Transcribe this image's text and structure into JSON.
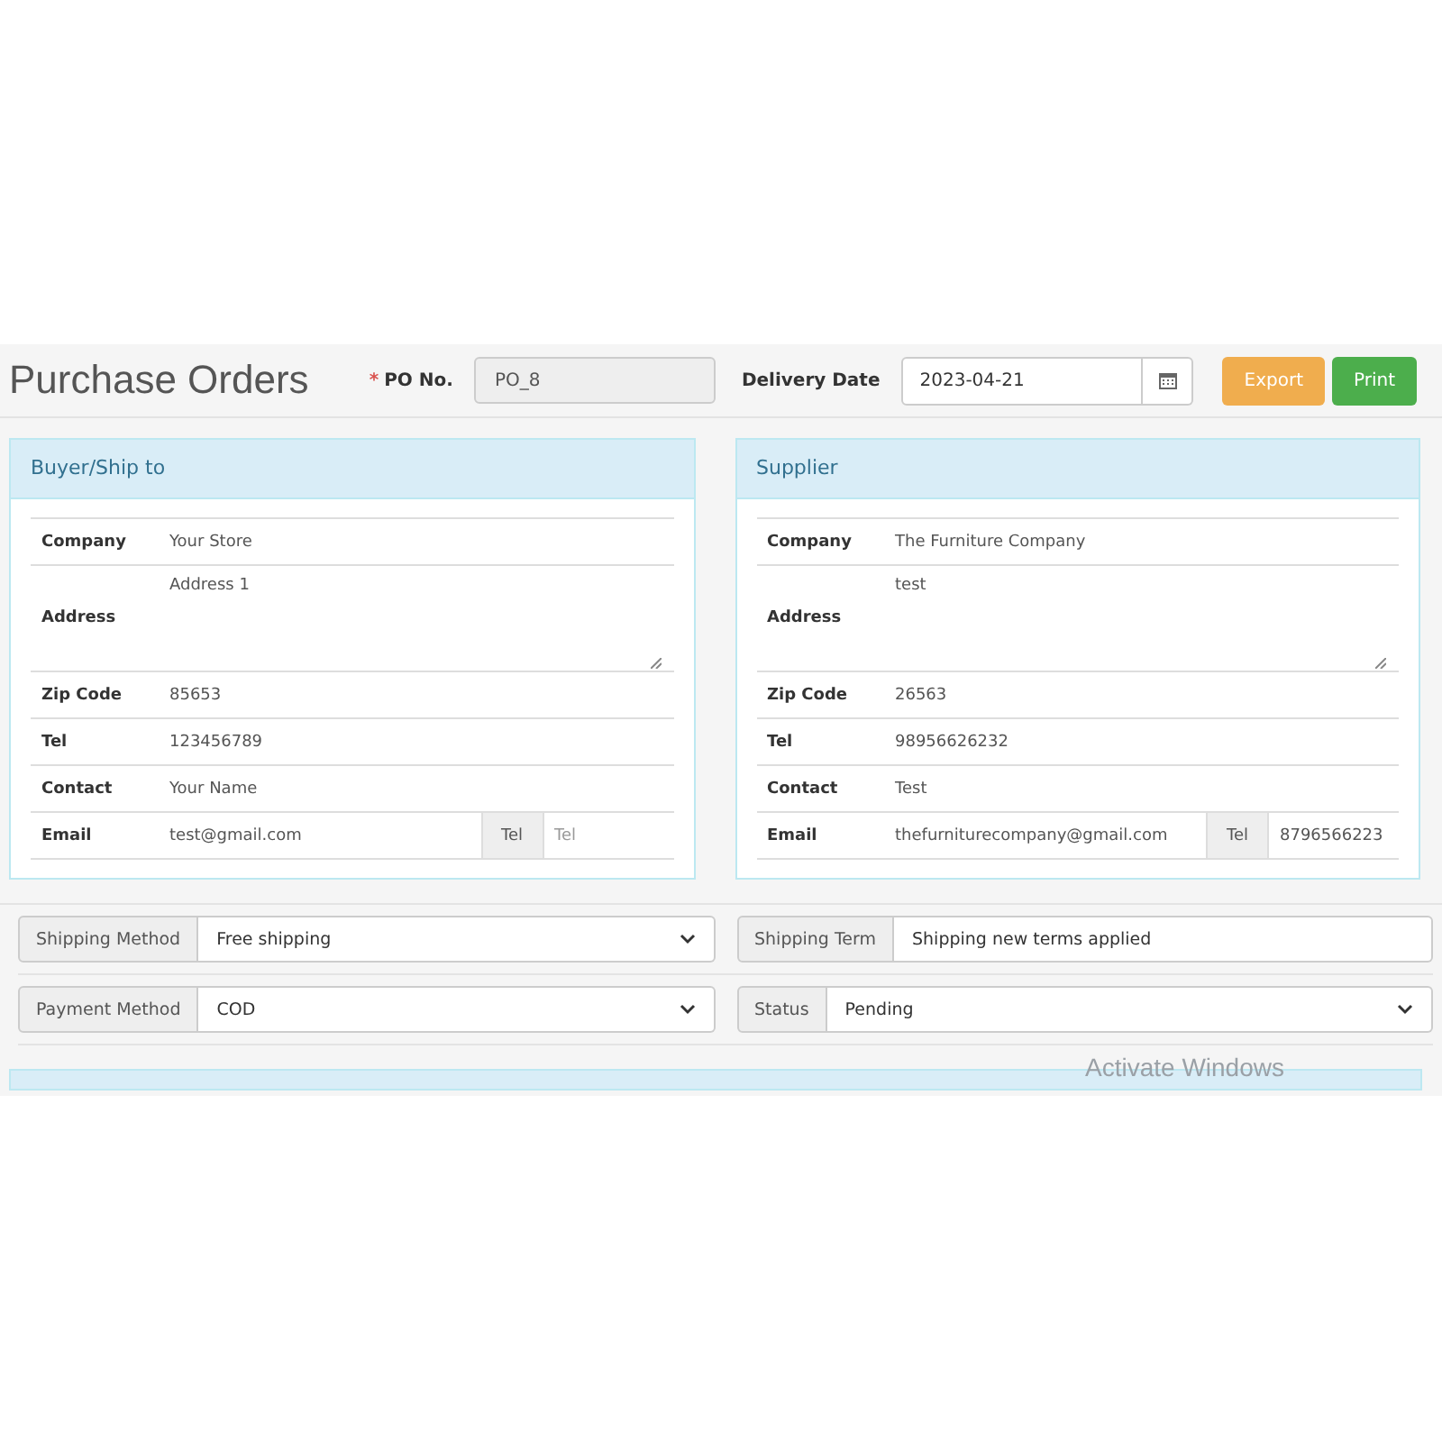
{
  "header": {
    "title": "Purchase Orders",
    "po_label": "PO No.",
    "required_mark": "*",
    "po_value": "PO_8",
    "delivery_label": "Delivery Date",
    "delivery_value": "2023-04-21",
    "buttons": [
      {
        "label": "Export",
        "kind": "warning"
      },
      {
        "label": "Print",
        "kind": "success"
      }
    ]
  },
  "panels": [
    {
      "title": "Buyer/Ship to",
      "rows": [
        {
          "kind": "text",
          "label": "Company",
          "value": "Your Store"
        },
        {
          "kind": "textarea",
          "label": "Address",
          "value": "Address 1"
        },
        {
          "kind": "text",
          "label": "Zip Code",
          "value": "85653"
        },
        {
          "kind": "text",
          "label": "Tel",
          "value": "123456789"
        },
        {
          "kind": "text",
          "label": "Contact",
          "value": "Your Name"
        },
        {
          "kind": "email",
          "label": "Email",
          "value": "test@gmail.com",
          "addon": "Tel",
          "placeholder": "Tel"
        }
      ]
    },
    {
      "title": "Supplier",
      "rows": [
        {
          "kind": "text",
          "label": "Company",
          "value": "The Furniture Company"
        },
        {
          "kind": "textarea",
          "label": "Address",
          "value": "test"
        },
        {
          "kind": "text",
          "label": "Zip Code",
          "value": "26563"
        },
        {
          "kind": "text",
          "label": "Tel",
          "value": "98956626232"
        },
        {
          "kind": "text",
          "label": "Contact",
          "value": "Test"
        },
        {
          "kind": "email",
          "label": "Email",
          "value": "thefurniturecompany@gmail.com",
          "addon": "Tel",
          "value_2": "8796566223"
        }
      ]
    }
  ],
  "options": [
    [
      {
        "kind": "select",
        "label": "Shipping Method",
        "value": "Free shipping"
      },
      {
        "kind": "input",
        "label": "Shipping Term",
        "value": "Shipping new terms applied"
      }
    ],
    [
      {
        "kind": "select",
        "label": "Payment Method",
        "value": "COD"
      },
      {
        "kind": "select",
        "label": "Status",
        "value": "Pending"
      }
    ]
  ],
  "overlay": {
    "text": "Activate Windows"
  }
}
